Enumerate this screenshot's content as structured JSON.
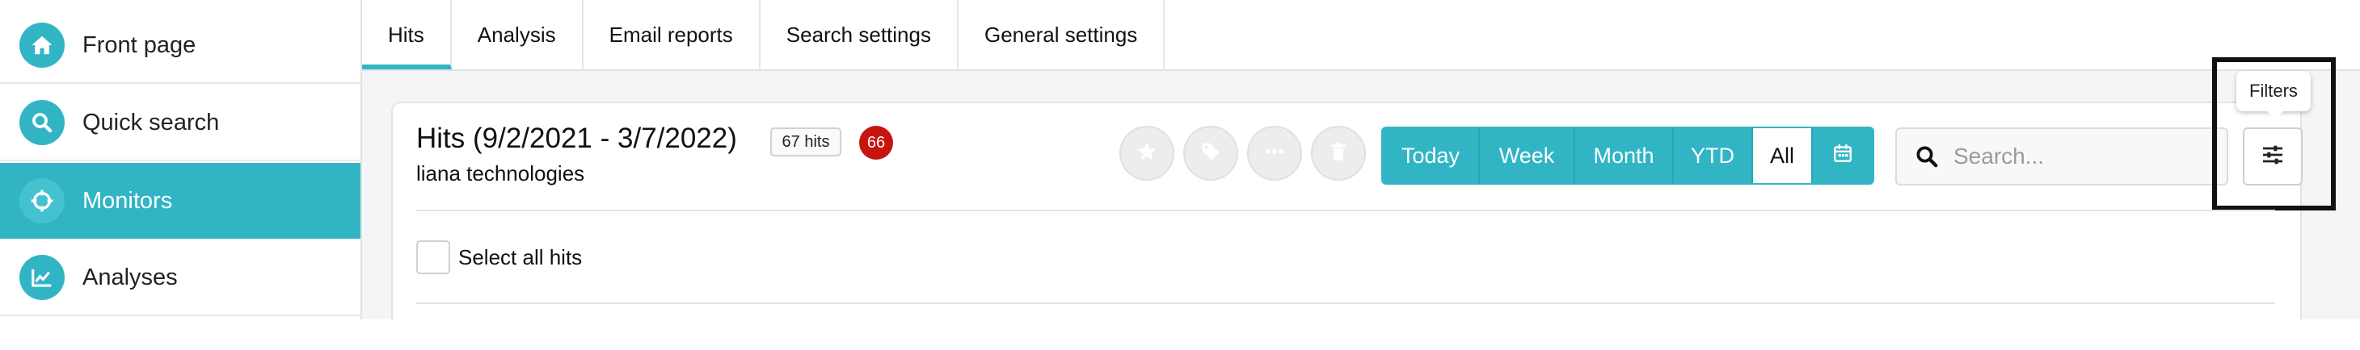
{
  "sidebar": {
    "items": [
      {
        "label": "Front page",
        "icon": "home-icon"
      },
      {
        "label": "Quick search",
        "icon": "search-icon"
      },
      {
        "label": "Monitors",
        "icon": "crosshair-icon",
        "active": true
      },
      {
        "label": "Analyses",
        "icon": "chart-icon"
      }
    ]
  },
  "tabs": [
    {
      "label": "Hits",
      "active": true
    },
    {
      "label": "Analysis"
    },
    {
      "label": "Email reports"
    },
    {
      "label": "Search settings"
    },
    {
      "label": "General settings"
    }
  ],
  "header": {
    "title": "Hits (9/2/2021 - 3/7/2022)",
    "subtitle": "liana technologies",
    "hits_badge": "67 hits",
    "count_badge": "66"
  },
  "actions": [
    "star-icon",
    "tag-icon",
    "more-icon",
    "trash-icon"
  ],
  "range": {
    "buttons": [
      "Today",
      "Week",
      "Month",
      "YTD",
      "All"
    ],
    "selected": "All",
    "calendar_icon": "calendar-icon"
  },
  "search": {
    "placeholder": "Search..."
  },
  "filters": {
    "tooltip": "Filters",
    "icon": "sliders-icon"
  },
  "select_all": {
    "label": "Select all hits"
  },
  "colors": {
    "accent": "#31b5c4",
    "badge_red": "#c8140f"
  }
}
